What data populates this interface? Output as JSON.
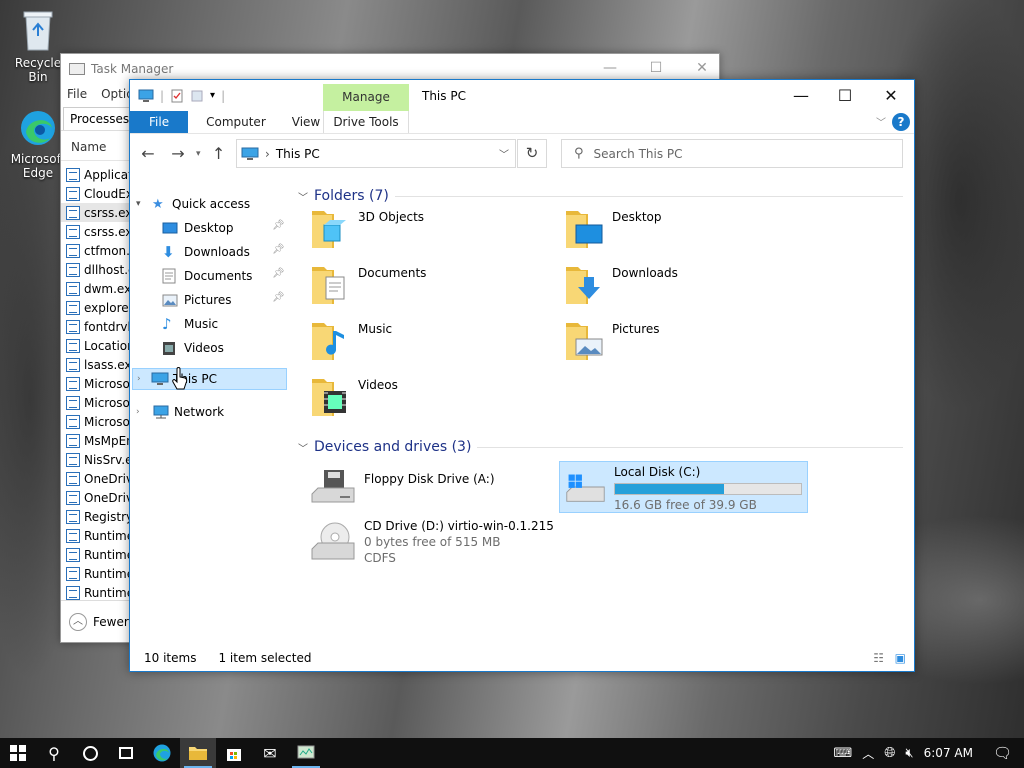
{
  "desktop": {
    "icons": [
      {
        "label": "Recycle Bin",
        "icon": "recycle-bin-icon"
      },
      {
        "label": "Microsoft Edge",
        "icon": "edge-icon"
      }
    ]
  },
  "task_manager": {
    "title": "Task Manager",
    "menu": [
      "File",
      "Options"
    ],
    "tab": "Processes",
    "column": "Name",
    "processes": [
      "Application",
      "CloudExp",
      "csrss.exe",
      "csrss.exe",
      "ctfmon.e",
      "dllhost.e",
      "dwm.exe",
      "explorer.",
      "fontdrvh",
      "Location",
      "lsass.exe",
      "Microsof",
      "Microsof",
      "Microsof",
      "MsMpEn",
      "NisSrv.ex",
      "OneDrive",
      "OneDrive",
      "Registry",
      "Runtime",
      "Runtime",
      "Runtime",
      "Runtime"
    ],
    "selected_index": 2,
    "footer": "Fewer"
  },
  "explorer": {
    "title": "This PC",
    "manage": "Manage",
    "tabs": {
      "file": "File",
      "computer": "Computer",
      "view": "View",
      "drive_tools": "Drive Tools"
    },
    "address": "This PC",
    "search_placeholder": "Search This PC",
    "nav": {
      "quick_access": "Quick access",
      "items": [
        "Desktop",
        "Downloads",
        "Documents",
        "Pictures",
        "Music",
        "Videos"
      ],
      "this_pc": "This PC",
      "network": "Network"
    },
    "folders_header": "Folders (7)",
    "folders": [
      "3D Objects",
      "Desktop",
      "Documents",
      "Downloads",
      "Music",
      "Pictures",
      "Videos"
    ],
    "devices_header": "Devices and drives (3)",
    "drives": {
      "floppy": "Floppy Disk Drive (A:)",
      "local": {
        "name": "Local Disk (C:)",
        "free": "16.6 GB free of 39.9 GB",
        "used_fraction": 0.584
      },
      "cd": {
        "name": "CD Drive (D:) virtio-win-0.1.215",
        "free": "0 bytes free of 515 MB",
        "fs": "CDFS"
      }
    },
    "status": {
      "count": "10 items",
      "selected": "1 item selected"
    }
  },
  "taskbar": {
    "time": "6:07 AM"
  },
  "colors": {
    "accent": "#1979ca",
    "selection": "#cce8ff",
    "manage": "#c5f0a0",
    "folder": "#f8d775",
    "progress": "#26a0da"
  }
}
